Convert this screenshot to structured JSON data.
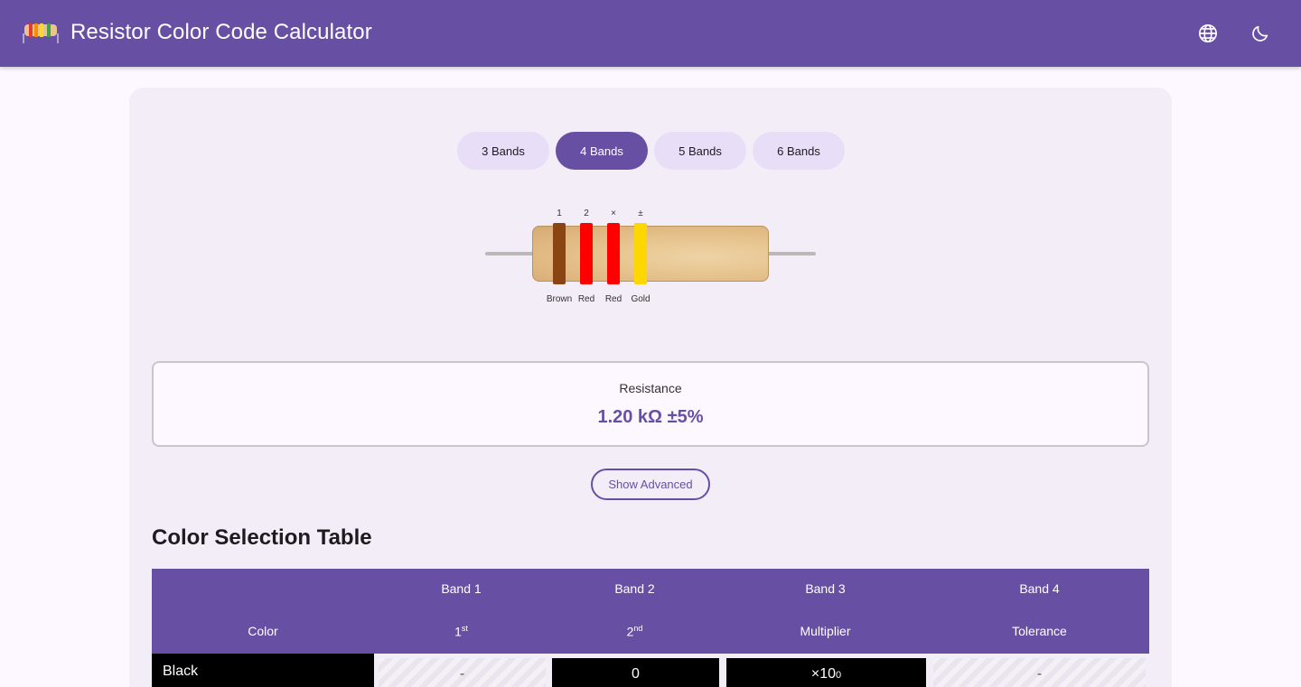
{
  "header": {
    "title": "Resistor Color Code Calculator",
    "bg_color": "#6750a4",
    "logo_icon": "resistor-logo-icon",
    "language_icon": "globe-icon",
    "theme_icon": "moon-icon"
  },
  "band_tabs": [
    {
      "label": "3 Bands",
      "active": false
    },
    {
      "label": "4 Bands",
      "active": true
    },
    {
      "label": "5 Bands",
      "active": false
    },
    {
      "label": "6 Bands",
      "active": false
    }
  ],
  "resistor": {
    "bands": [
      {
        "index_label": "1",
        "name": "Brown",
        "color": "#8b4513"
      },
      {
        "index_label": "2",
        "name": "Red",
        "color": "#ff0000"
      },
      {
        "index_label": "×",
        "name": "Red",
        "color": "#ff0000"
      },
      {
        "index_label": "±",
        "name": "Gold",
        "color": "#ffd700"
      }
    ]
  },
  "result": {
    "label": "Resistance",
    "value": "1.20 kΩ ±5%"
  },
  "advanced_button": "Show Advanced",
  "table": {
    "title": "Color Selection Table",
    "header_row1": [
      "",
      "Band 1",
      "Band 2",
      "Band 3",
      "Band 4"
    ],
    "header_row2": {
      "color": "Color",
      "band1_main": "1",
      "band1_sup": "st",
      "band2_main": "2",
      "band2_sup": "nd",
      "band3": "Multiplier",
      "band4": "Tolerance"
    },
    "rows": [
      {
        "name": "Black",
        "band1": "-",
        "band2": "0",
        "multiplier_base": "×10",
        "multiplier_exp": "0",
        "tolerance": "-"
      }
    ]
  }
}
